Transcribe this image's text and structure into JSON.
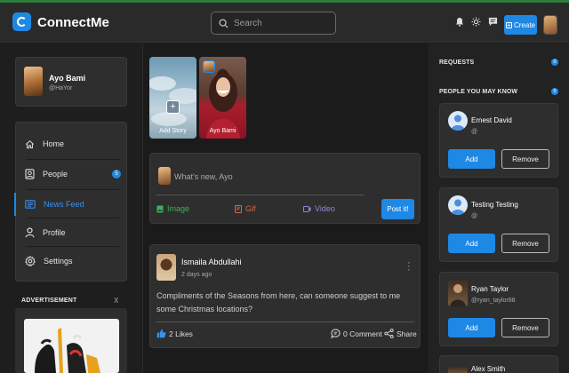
{
  "app": {
    "brand": "ConnectMe"
  },
  "search": {
    "placeholder": "Search"
  },
  "header": {
    "create_label": "Create"
  },
  "profile": {
    "name": "Ayo Bami",
    "handle": "@HaYor"
  },
  "menu": {
    "items": [
      {
        "label": "Home",
        "icon": "home-icon"
      },
      {
        "label": "People",
        "icon": "people-icon",
        "badge": "5"
      },
      {
        "label": "News Feed",
        "icon": "newsfeed-icon",
        "active": true
      },
      {
        "label": "Profile",
        "icon": "profile-icon"
      },
      {
        "label": "Settings",
        "icon": "settings-icon"
      }
    ]
  },
  "ad": {
    "title": "ADVERTISEMENT",
    "close": "X"
  },
  "stories": [
    {
      "label": "Add Story"
    },
    {
      "label": "Ayo Bami"
    }
  ],
  "composer": {
    "placeholder": "What's new, Ayo",
    "actions": [
      {
        "label": "Image",
        "color": "#3fae5a"
      },
      {
        "label": "Gif",
        "color": "#e0654a"
      },
      {
        "label": "Video",
        "color": "#8a8ad8"
      }
    ],
    "post_label": "Post it!"
  },
  "post": {
    "author": "Ismaila Abdullahi",
    "time": "2 days ago",
    "text": "Compliments of the Seasons from here, can someone suggest to me some Christmas locations?",
    "likes": "2 Likes",
    "comments": "0 Comment",
    "share": "Share"
  },
  "requests": {
    "title": "REQUESTS",
    "count": "0"
  },
  "suggestions": {
    "title": "PEOPLE YOU MAY KNOW",
    "count": "5",
    "add_label": "Add",
    "remove_label": "Remove",
    "people": [
      {
        "name": "Ernest David",
        "handle": "@"
      },
      {
        "name": "Testing Testing",
        "handle": "@"
      },
      {
        "name": "Ryan Taylor",
        "handle": "@ryan_taylor88"
      },
      {
        "name": "Alex Smith",
        "handle": ""
      }
    ]
  },
  "colors": {
    "accent": "#1e88e5",
    "background": "#1b1b1b",
    "card": "#2e2e2e"
  }
}
